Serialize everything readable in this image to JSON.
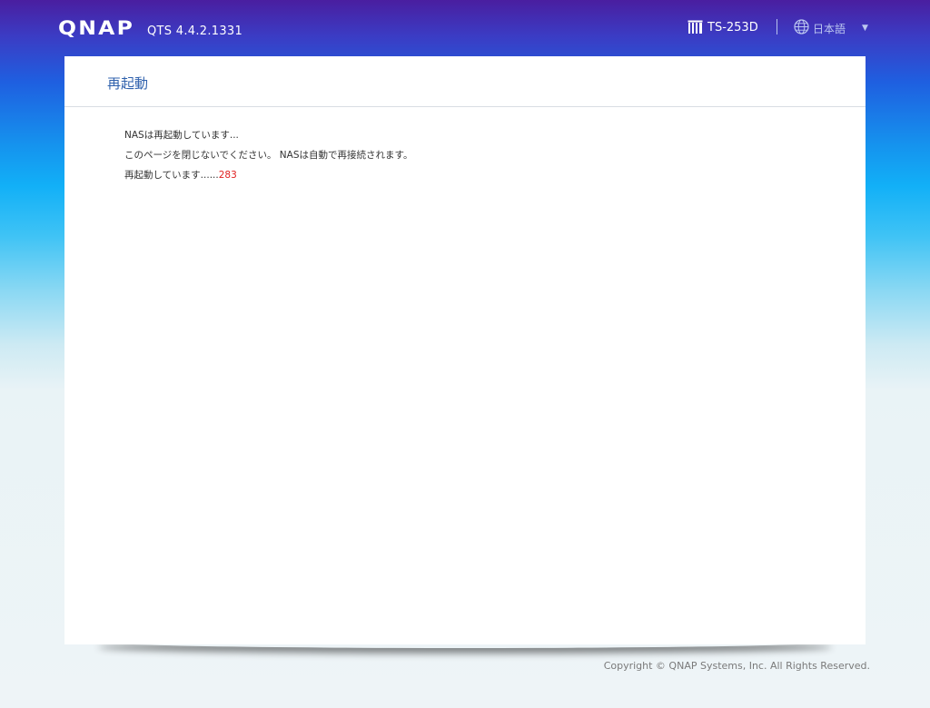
{
  "header": {
    "logo": "QNAP",
    "version": "QTS 4.4.2.1331",
    "model": "TS-253D",
    "language": "日本語"
  },
  "panel": {
    "title": "再起動",
    "line1": "NASは再起動しています...",
    "line2": "このページを閉じないでください。 NASは自動で再接続されます。",
    "line3_prefix": "再起動しています......",
    "countdown": "283"
  },
  "footer": {
    "copyright": "Copyright © QNAP Systems, Inc. All Rights Reserved."
  },
  "icons": {
    "model": "nas-device-icon",
    "language": "globe-icon",
    "dropdown": "caret-down-icon"
  },
  "colors": {
    "title": "#2f61ad",
    "countdown": "#e02020"
  }
}
